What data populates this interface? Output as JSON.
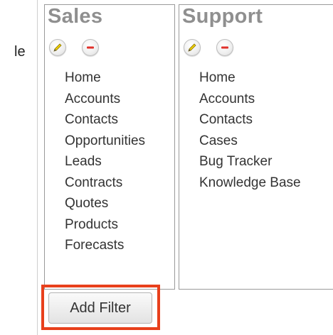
{
  "left": {
    "label_fragment": "le"
  },
  "tabs": [
    {
      "title": "Sales",
      "modules": [
        "Home",
        "Accounts",
        "Contacts",
        "Opportunities",
        "Leads",
        "Contracts",
        "Quotes",
        "Products",
        "Forecasts"
      ],
      "icons": {
        "edit": "pencil-icon",
        "remove": "minus-icon"
      }
    },
    {
      "title": "Support",
      "modules": [
        "Home",
        "Accounts",
        "Contacts",
        "Cases",
        "Bug Tracker",
        "Knowledge Base"
      ],
      "icons": {
        "edit": "pencil-icon",
        "remove": "minus-icon"
      }
    }
  ],
  "add_filter": {
    "label": "Add Filter",
    "highlight_color": "#e8401c"
  },
  "colors": {
    "tab_title": "#8f8f8f",
    "remove_icon": "#e0302a",
    "edit_icon": "#d9b400"
  }
}
